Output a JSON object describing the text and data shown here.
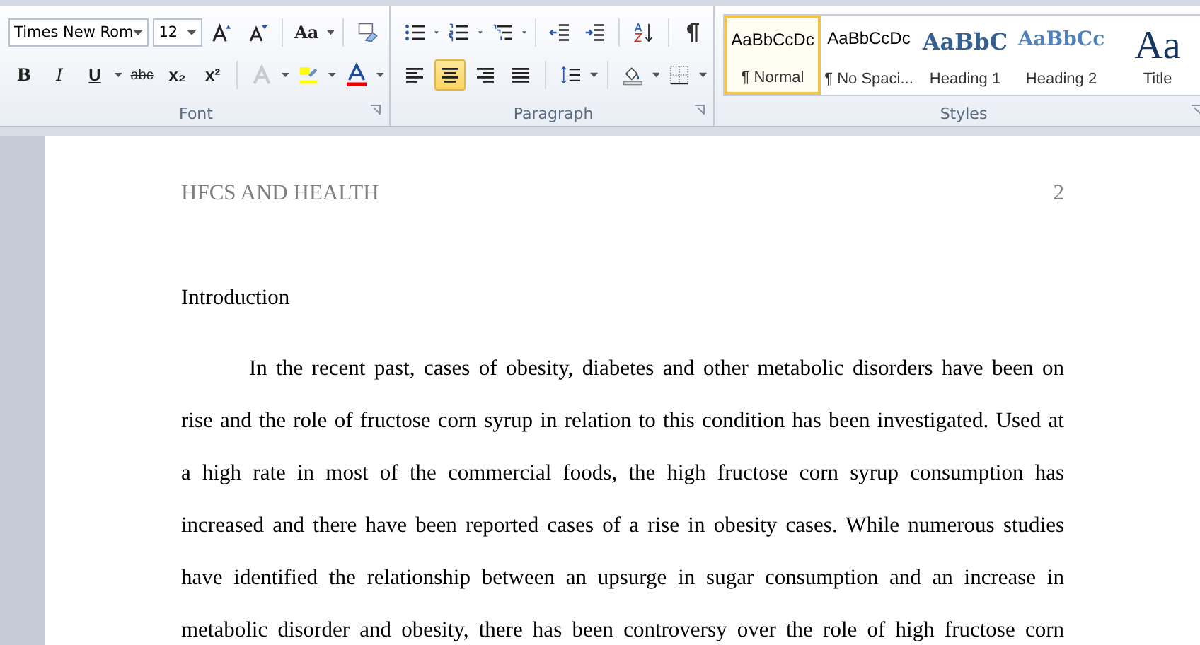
{
  "ribbon": {
    "font": {
      "label": "Font",
      "font_name": "Times New Rom",
      "font_size": "12",
      "case_button": "Aa",
      "format_buttons": [
        {
          "label": "B",
          "kind": "bold"
        },
        {
          "label": "I",
          "kind": "italic"
        },
        {
          "label": "U",
          "kind": "underline"
        },
        {
          "label": "abc",
          "kind": "strike"
        },
        {
          "label": "x₂",
          "kind": "sub"
        },
        {
          "label": "x²",
          "kind": "sup"
        }
      ]
    },
    "paragraph": {
      "label": "Paragraph",
      "alignment": [
        {
          "selected": false
        },
        {
          "selected": true
        },
        {
          "selected": false
        },
        {
          "selected": false
        }
      ]
    },
    "styles": {
      "label": "Styles",
      "items": [
        {
          "preview": "AaBbCcDc",
          "label": "¶ Normal",
          "kind": "normal",
          "selected": true
        },
        {
          "preview": "AaBbCcDc",
          "label": "¶ No Spaci...",
          "kind": "plain",
          "selected": false
        },
        {
          "preview": "AaBbC",
          "label": "Heading 1",
          "kind": "heading1",
          "selected": false
        },
        {
          "preview": "AaBbCc",
          "label": "Heading 2",
          "kind": "heading2",
          "selected": false
        },
        {
          "preview": "Aa",
          "label": "Title",
          "kind": "title",
          "selected": false
        }
      ]
    }
  },
  "document": {
    "header": {
      "title": "HFCS AND HEALTH",
      "page_number": "2"
    },
    "heading": "Introduction",
    "paragraph_lines": [
      "In the recent past, cases of obesity, diabetes and other metabolic disorders have been on",
      "rise and the role of fructose corn syrup in relation to this condition has been investigated. Used at",
      "a high rate in most of the commercial  foods, the high fructose corn syrup consumption has",
      "increased and there have been reported cases of a rise in obesity cases. While numerous studies",
      "have identified the relationship between an upsurge in sugar consumption and an increase in",
      "metabolic disorder and obesity, there has been controversy over the role of high fructose corn"
    ]
  }
}
